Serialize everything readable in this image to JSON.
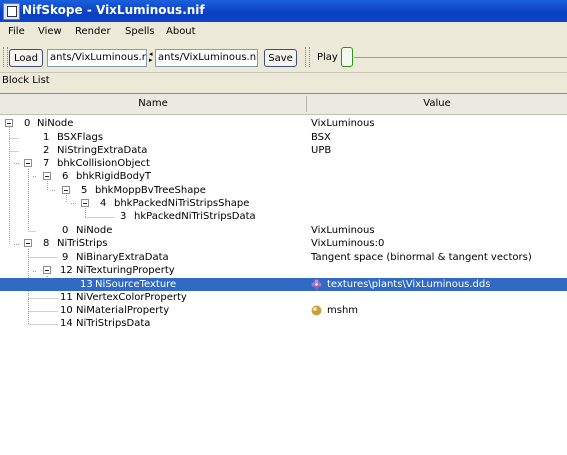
{
  "window": {
    "title": "NifSkope - VixLuminous.nif"
  },
  "menu": [
    "File",
    "View",
    "Render",
    "Spells",
    "About"
  ],
  "toolbar": {
    "load_label": "Load",
    "load_path": "ants/VixLuminous.nif",
    "save_path": "ants/VixLuminous.nif",
    "save_label": "Save",
    "play_label": "Play"
  },
  "block_list": {
    "title": "Block List",
    "columns": {
      "name": "Name",
      "value": "Value"
    },
    "rows": [
      {
        "id": "0",
        "name": "NiNode",
        "value": "VixLuminous"
      },
      {
        "id": "1",
        "name": "BSXFlags",
        "value": "BSX"
      },
      {
        "id": "2",
        "name": "NiStringExtraData",
        "value": "UPB"
      },
      {
        "id": "7",
        "name": "bhkCollisionObject",
        "value": ""
      },
      {
        "id": "6",
        "name": "bhkRigidBodyT",
        "value": ""
      },
      {
        "id": "5",
        "name": "bhkMoppBvTreeShape",
        "value": ""
      },
      {
        "id": "4",
        "name": "bhkPackedNiTriStripsShape",
        "value": ""
      },
      {
        "id": "3",
        "name": "hkPackedNiTriStripsData",
        "value": ""
      },
      {
        "id": "0",
        "name": "NiNode",
        "value": "VixLuminous"
      },
      {
        "id": "8",
        "name": "NiTriStrips",
        "value": "VixLuminous:0"
      },
      {
        "id": "9",
        "name": "NiBinaryExtraData",
        "value": "Tangent space (binormal & tangent vectors)"
      },
      {
        "id": "12",
        "name": "NiTexturingProperty",
        "value": ""
      },
      {
        "id": "13",
        "name": "NiSourceTexture",
        "value": "textures\\plants\\VixLuminous.dds"
      },
      {
        "id": "11",
        "name": "NiVertexColorProperty",
        "value": ""
      },
      {
        "id": "10",
        "name": "NiMaterialProperty",
        "value": "mshm"
      },
      {
        "id": "14",
        "name": "NiTriStripsData",
        "value": ""
      }
    ]
  },
  "colors": {
    "titlebar": "#0a3fc2",
    "selection": "#316ac5",
    "window_bg": "#ece9d8"
  },
  "icons": {
    "texture_value": "texture-flower-icon",
    "material_value": "material-sphere-icon"
  }
}
